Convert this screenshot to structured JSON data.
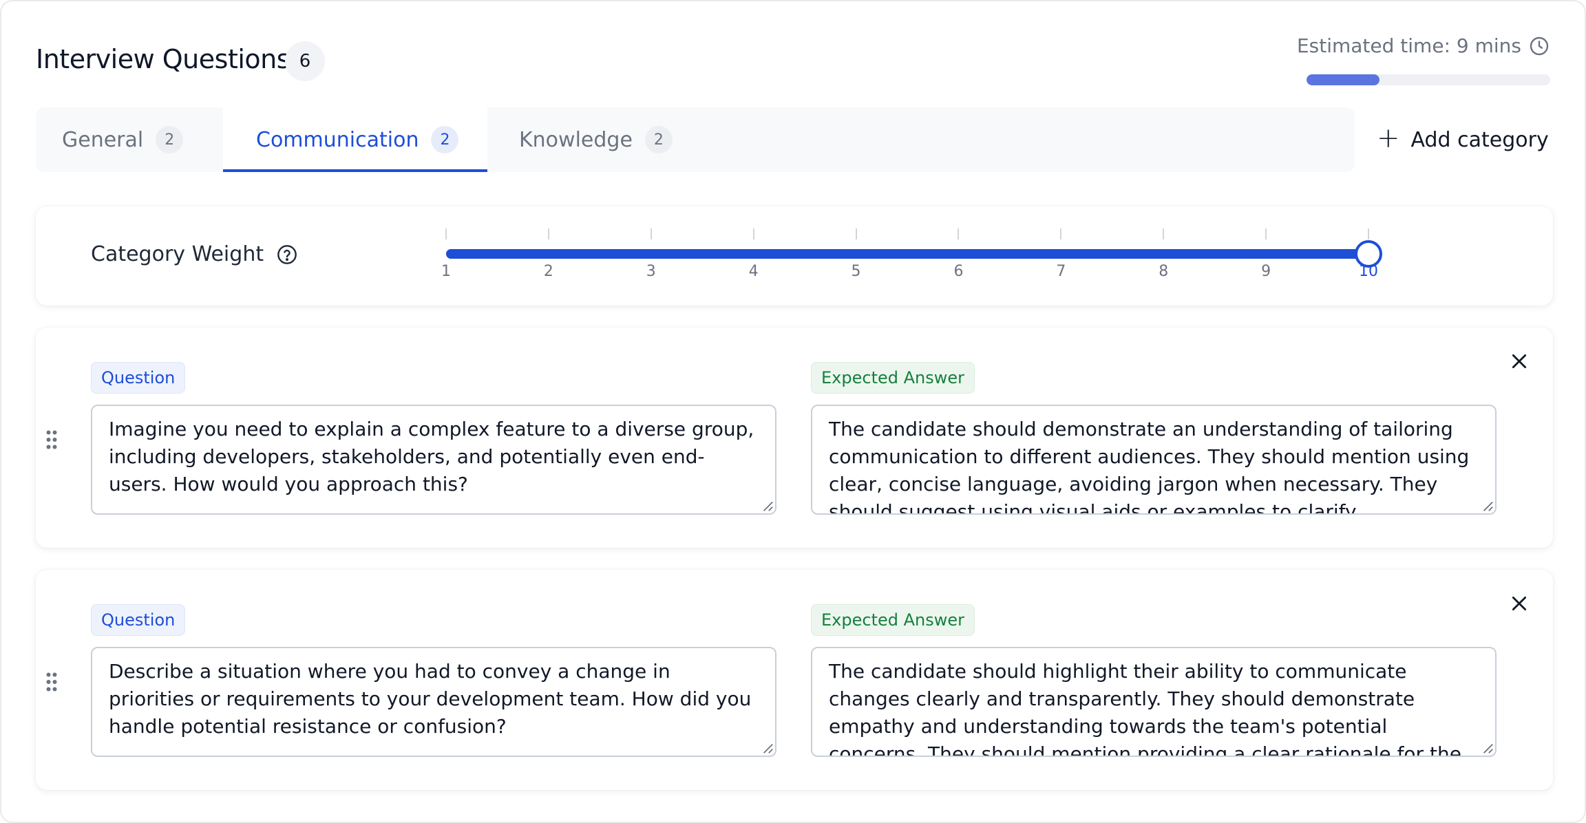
{
  "header": {
    "title": "Interview Questions",
    "count": "6",
    "estimated_time": "Estimated time: 9 mins",
    "progress_fraction": 0.3
  },
  "tabs": [
    {
      "label": "General",
      "count": "2",
      "active": false
    },
    {
      "label": "Communication",
      "count": "2",
      "active": true
    },
    {
      "label": "Knowledge",
      "count": "2",
      "active": false
    }
  ],
  "add_category_label": "Add category",
  "category_weight": {
    "label": "Category Weight",
    "ticks": [
      "1",
      "2",
      "3",
      "4",
      "5",
      "6",
      "7",
      "8",
      "9",
      "10"
    ],
    "value": 10
  },
  "questions": [
    {
      "question_label": "Question",
      "answer_label": "Expected Answer",
      "question": "Imagine you need to explain a complex feature to a diverse group, including developers, stakeholders, and potentially even end-users. How would you approach this?",
      "answer": "The candidate should demonstrate an understanding of tailoring communication to different audiences. They should mention using clear, concise language, avoiding jargon when necessary. They should suggest using visual aids or examples to clarify"
    },
    {
      "question_label": "Question",
      "answer_label": "Expected Answer",
      "question": "Describe a situation where you had to convey a change in priorities or requirements to your development team. How did you handle potential resistance or confusion?",
      "answer": "The candidate should highlight their ability to communicate changes clearly and transparently. They should demonstrate empathy and understanding towards the team's potential concerns. They should mention providing a clear rationale for the"
    }
  ],
  "colors": {
    "accent": "#1d4ed8",
    "progress": "#5b75e0",
    "answer_pill": "#15803d"
  }
}
